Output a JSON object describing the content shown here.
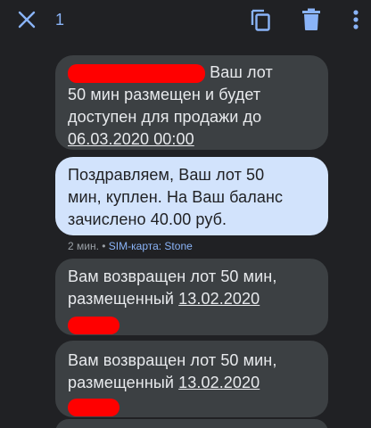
{
  "toolbar": {
    "selected_count": "1",
    "close_icon": "close-icon",
    "copy_icon": "copy-icon",
    "delete_icon": "delete-icon",
    "more_icon": "more-vert-icon",
    "accent": "#8ab4f8"
  },
  "messages": [
    {
      "line1_suffix": " Ваш лот",
      "line2": "50 мин размещен и будет",
      "line3": "доступен для продажи до",
      "date": "06.03.2020 00:00"
    },
    {
      "line1": "Поздравляем, Ваш лот 50",
      "line2": "мин, куплен. На Ваш баланс",
      "line3": "зачислено 40.00 руб."
    },
    {
      "line1": "Вам возвращен лот 50 мин,",
      "line2_prefix": "размещенный ",
      "date": "13.02.2020"
    },
    {
      "line1": "Вам возвращен лот 50 мин,",
      "line2_prefix": "размещенный ",
      "date": "13.02.2020"
    }
  ],
  "meta": {
    "time": "2 мин.",
    "separator": " • ",
    "sim": "SIM-карта: Stone"
  },
  "colors": {
    "background": "#202124",
    "incoming_bubble": "#3c4043",
    "outgoing_bubble": "#d2e3fc",
    "redaction": "#ff0000"
  }
}
